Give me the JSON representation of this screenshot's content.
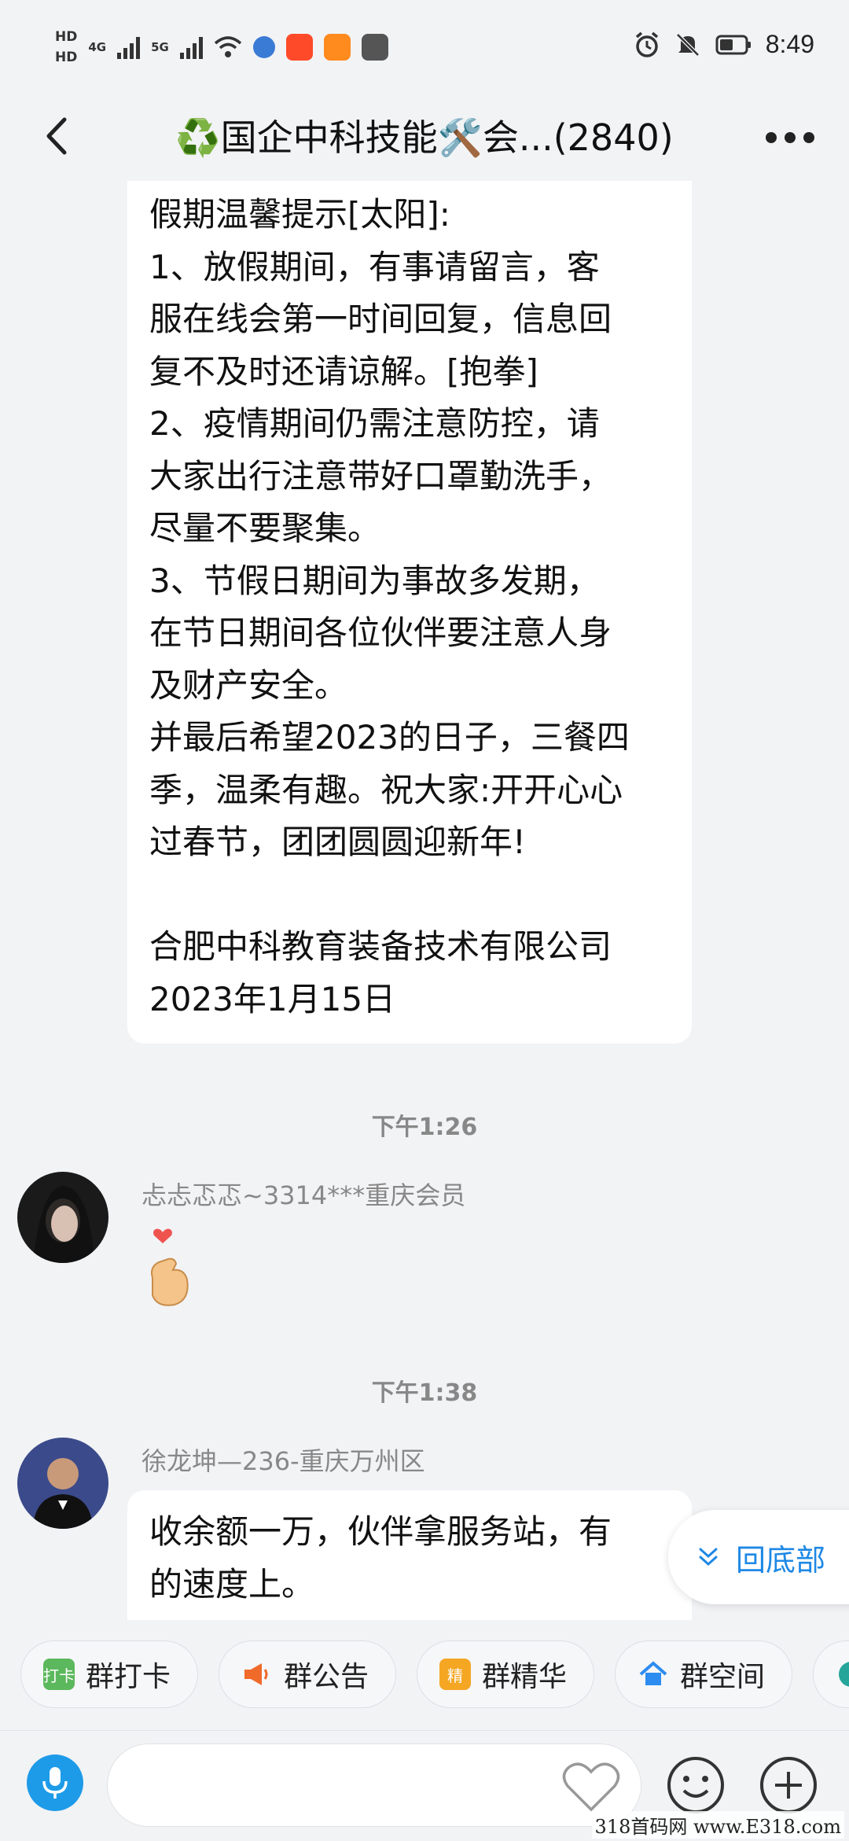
{
  "status_bar": {
    "hd1": "HD",
    "hd2": "HD",
    "net1": "4G",
    "net2": "5G",
    "time": "8:49"
  },
  "nav": {
    "title": "♻️国企中科技能🛠️会...(2840)"
  },
  "messages": {
    "announcement_lines": [
      "假期温馨提示[太阳]:",
      "1、放假期间，有事请留言，客",
      "服在线会第一时间回复，信息回",
      "复不及时还请谅解。[抱拳]",
      "2、疫情期间仍需注意防控，请",
      "大家出行注意带好口罩勤洗手，",
      "尽量不要聚集。",
      "3、节假日期间为事故多发期，",
      "在节日期间各位伙伴要注意人身",
      "及财产安全。",
      "并最后希望2023的日子，三餐四",
      "季，温柔有趣。祝大家:开开心心",
      "过春节，团团圆圆迎新年!",
      "",
      "合肥中科教育装备技术有限公司",
      "2023年1月15日"
    ],
    "time1": "下午1:26",
    "sender1": "忐忐忑忑~3314***重庆会员",
    "time2": "下午1:38",
    "sender2": "徐龙坤—236-重庆万州区",
    "msg2_line1": "收余额一万，伙伴拿服务站，有",
    "msg2_line2": "的速度上。"
  },
  "to_bottom_label": "回底部",
  "toolbar": {
    "checkin": "群打卡",
    "checkin_icon_text": "打卡",
    "notice": "群公告",
    "essence": "群精华",
    "essence_icon_text": "精",
    "space": "群空间"
  },
  "watermark": "318首码网 www.E318.com"
}
